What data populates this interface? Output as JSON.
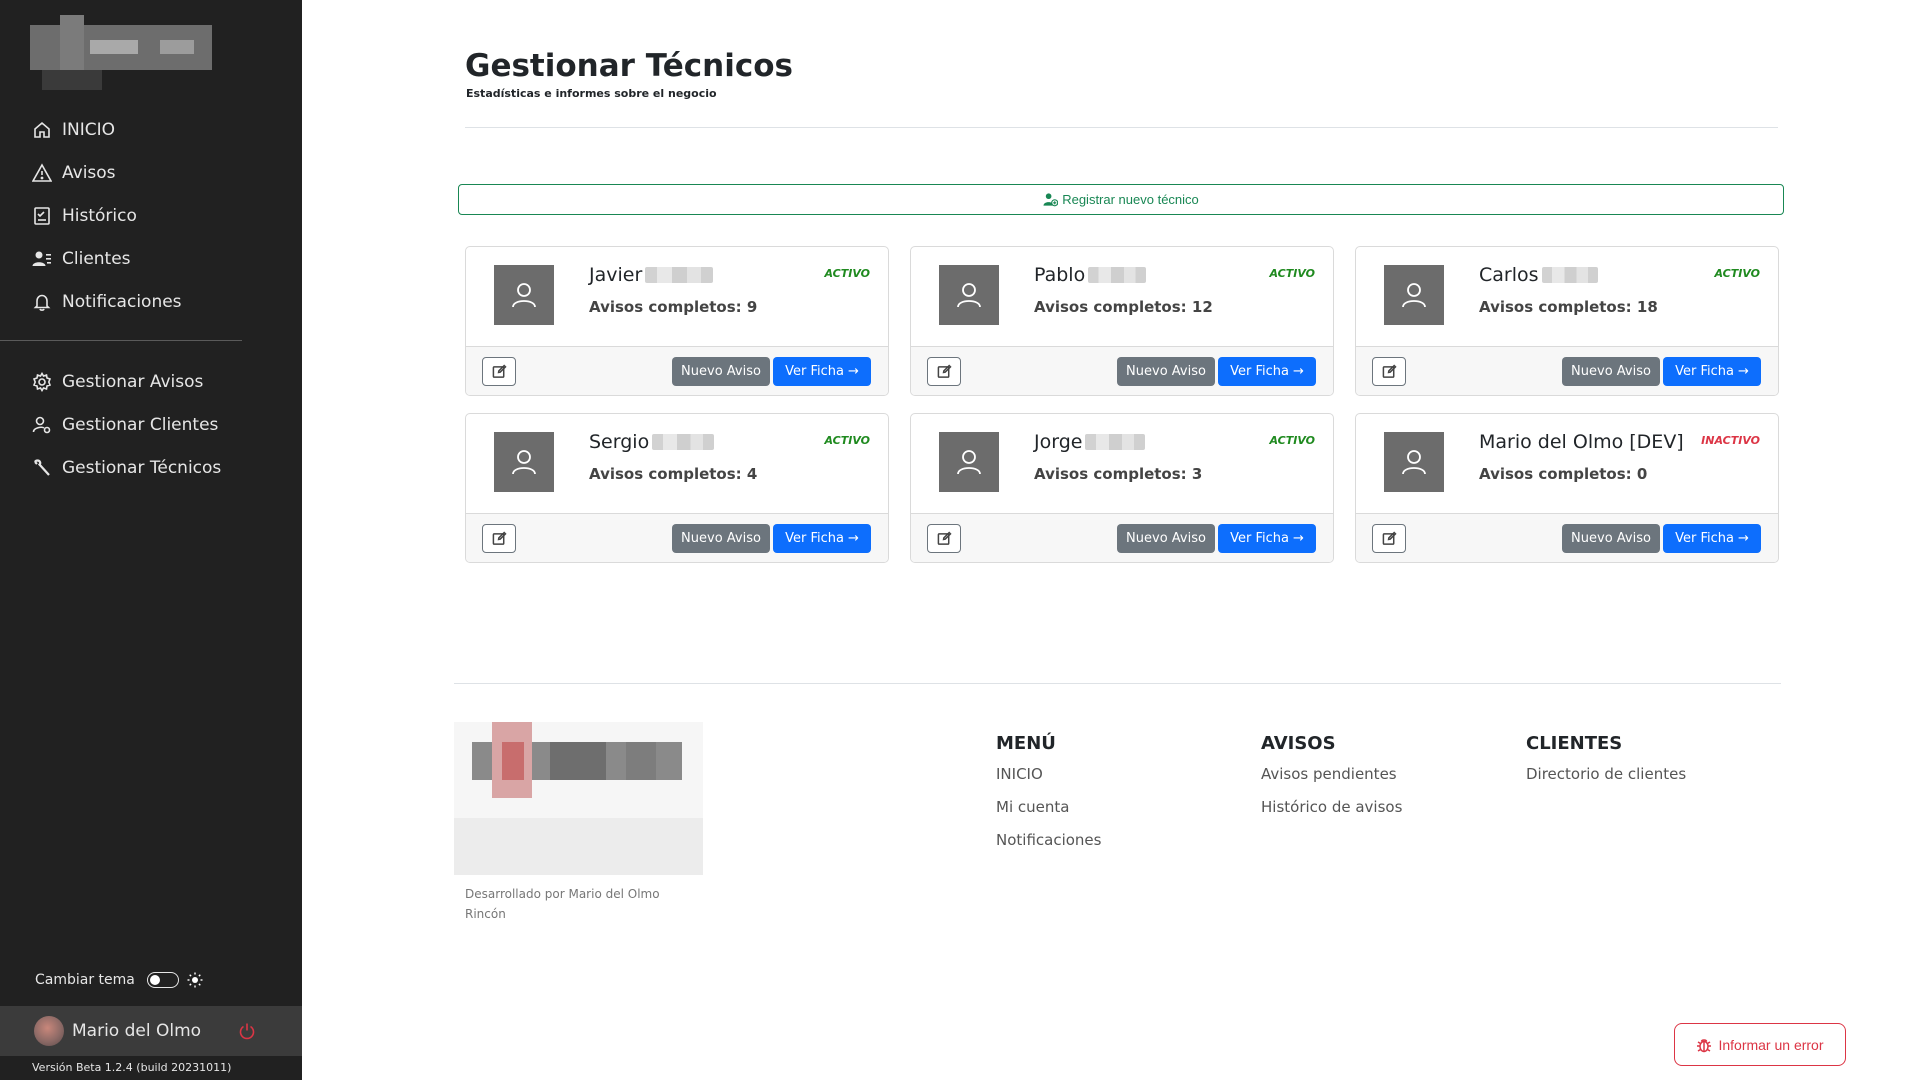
{
  "sidebar": {
    "nav": [
      {
        "label": "INICIO",
        "icon": "home-icon"
      },
      {
        "label": "Avisos",
        "icon": "warning-icon"
      },
      {
        "label": "Histórico",
        "icon": "history-checklist-icon"
      },
      {
        "label": "Clientes",
        "icon": "clients-icon"
      },
      {
        "label": "Notificaciones",
        "icon": "bell-icon"
      }
    ],
    "manage": [
      {
        "label": "Gestionar Avisos",
        "icon": "gear-icon"
      },
      {
        "label": "Gestionar Clientes",
        "icon": "person-gear-icon"
      },
      {
        "label": "Gestionar Técnicos",
        "icon": "wrench-icon"
      }
    ],
    "theme_label": "Cambiar tema",
    "user_name": "Mario del Olmo",
    "version": "Versión Beta 1.2.4 (build 20231011)"
  },
  "header": {
    "title": "Gestionar Técnicos",
    "subtitle": "Estadísticas e informes sobre el negocio"
  },
  "register_button": "Registrar nuevo técnico",
  "technicians": [
    {
      "name": "Javier",
      "surname_blurred": true,
      "count_label": "Avisos completos: 9",
      "status": "ACTIVO",
      "active": true
    },
    {
      "name": "Pablo",
      "surname_blurred": true,
      "count_label": "Avisos completos: 12",
      "status": "ACTIVO",
      "active": true
    },
    {
      "name": "Carlos",
      "surname_blurred": true,
      "count_label": "Avisos completos: 18",
      "status": "ACTIVO",
      "active": true
    },
    {
      "name": "Sergio",
      "surname_blurred": true,
      "count_label": "Avisos completos: 4",
      "status": "ACTIVO",
      "active": true
    },
    {
      "name": "Jorge",
      "surname_blurred": true,
      "count_label": "Avisos completos: 3",
      "status": "ACTIVO",
      "active": true
    },
    {
      "name": "Mario del Olmo [DEV]",
      "surname_blurred": false,
      "count_label": "Avisos completos: 0",
      "status": "INACTIVO",
      "active": false
    }
  ],
  "card_buttons": {
    "new_label": "Nuevo Aviso",
    "view_label": "Ver Ficha"
  },
  "footer": {
    "developer": "Desarrollado por Mario del Olmo Rincón",
    "columns": [
      {
        "title": "MENÚ",
        "links": [
          "INICIO",
          "Mi cuenta",
          "Notificaciones"
        ]
      },
      {
        "title": "AVISOS",
        "links": [
          "Avisos pendientes",
          "Histórico de avisos"
        ]
      },
      {
        "title": "CLIENTES",
        "links": [
          "Directorio de clientes"
        ]
      }
    ]
  },
  "report_button": "Informar un error",
  "colors": {
    "sidebar_bg": "#212121",
    "success": "#198754",
    "primary": "#0d6efd",
    "secondary": "#6c757d",
    "danger": "#dc3545"
  }
}
